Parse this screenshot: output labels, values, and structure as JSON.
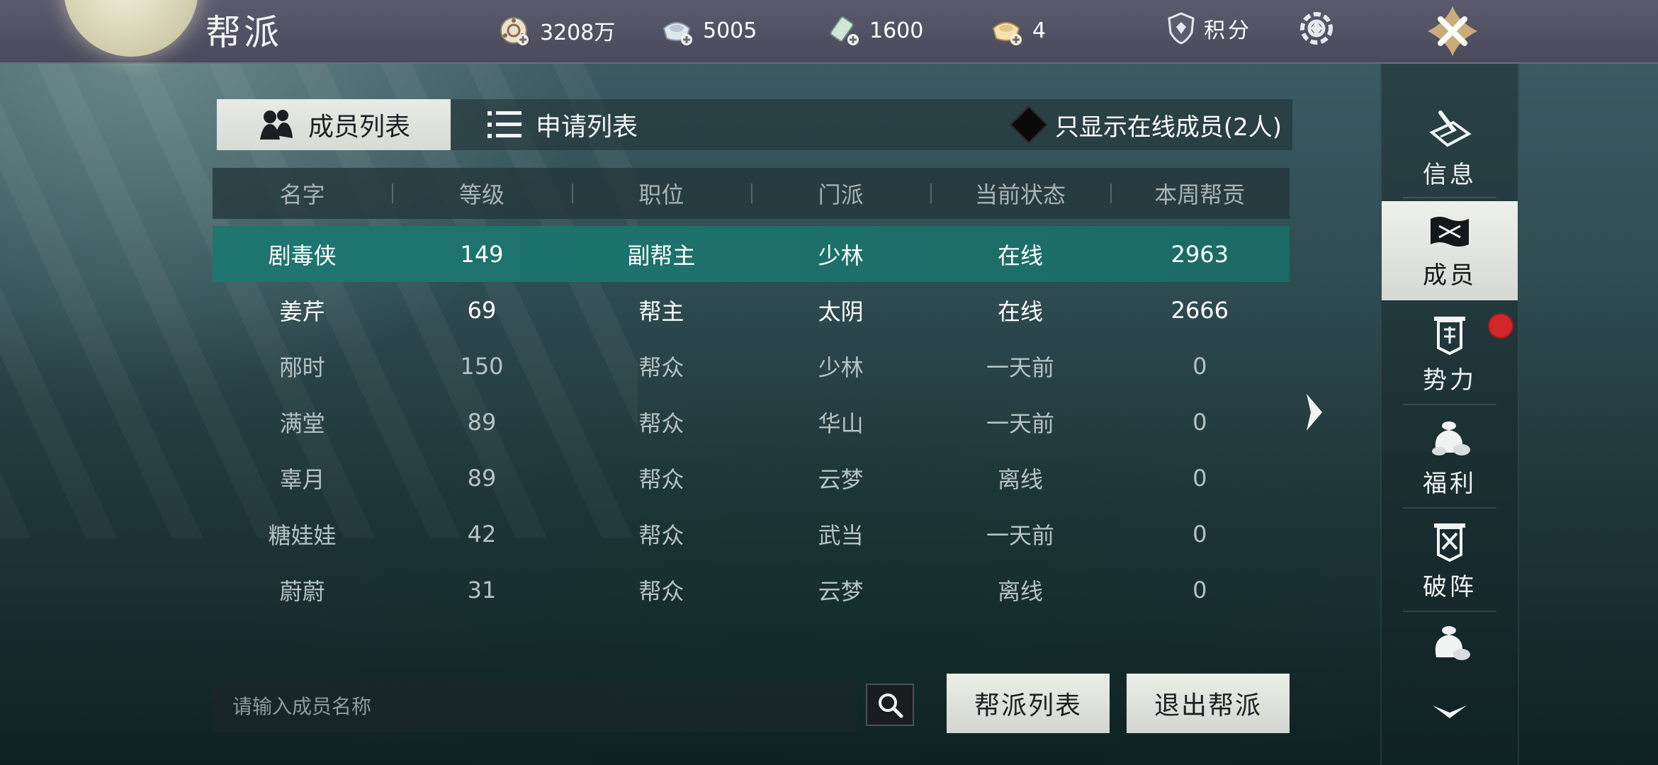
{
  "header": {
    "title": "帮派",
    "resources": [
      {
        "icon": "coin-reel-icon",
        "value": "3208万"
      },
      {
        "icon": "silver-ingot-icon",
        "value": "5005"
      },
      {
        "icon": "jade-token-icon",
        "value": "1600"
      },
      {
        "icon": "gold-ingot-icon",
        "value": "4"
      }
    ],
    "points_label": "积分"
  },
  "tabs": {
    "members": "成员列表",
    "applications": "申请列表",
    "online_filter": "只显示在线成员(2人)"
  },
  "table": {
    "headers": [
      "名字",
      "等级",
      "职位",
      "门派",
      "当前状态",
      "本周帮贡"
    ],
    "rows": [
      {
        "name": "剧毒侠",
        "level": "149",
        "role": "副帮主",
        "sect": "少林",
        "status": "在线",
        "contribution": "2963",
        "state": "selected"
      },
      {
        "name": "姜芹",
        "level": "69",
        "role": "帮主",
        "sect": "太阴",
        "status": "在线",
        "contribution": "2666",
        "state": "online"
      },
      {
        "name": "邴时",
        "level": "150",
        "role": "帮众",
        "sect": "少林",
        "status": "一天前",
        "contribution": "0",
        "state": "offline"
      },
      {
        "name": "满堂",
        "level": "89",
        "role": "帮众",
        "sect": "华山",
        "status": "一天前",
        "contribution": "0",
        "state": "offline"
      },
      {
        "name": "辜月",
        "level": "89",
        "role": "帮众",
        "sect": "云梦",
        "status": "离线",
        "contribution": "0",
        "state": "offline"
      },
      {
        "name": "糖娃娃",
        "level": "42",
        "role": "帮众",
        "sect": "武当",
        "status": "一天前",
        "contribution": "0",
        "state": "offline"
      },
      {
        "name": "蔚蔚",
        "level": "31",
        "role": "帮众",
        "sect": "云梦",
        "status": "离线",
        "contribution": "0",
        "state": "offline"
      }
    ]
  },
  "search": {
    "placeholder": "请输入成员名称",
    "value": ""
  },
  "buttons": {
    "guild_list": "帮派列表",
    "leave_guild": "退出帮派"
  },
  "sidebar": {
    "items": [
      {
        "label": "信息",
        "icon": "scroll-pen-icon"
      },
      {
        "label": "成员",
        "icon": "banner-scroll-icon",
        "active": true
      },
      {
        "label": "势力",
        "icon": "faction-banner-icon",
        "badge": true
      },
      {
        "label": "福利",
        "icon": "money-bag-icon"
      },
      {
        "label": "破阵",
        "icon": "crossed-swords-icon"
      }
    ]
  },
  "colors": {
    "selected_row": "#1f7670",
    "badge": "#d0282a",
    "tab_active": "#e8ebe6"
  }
}
